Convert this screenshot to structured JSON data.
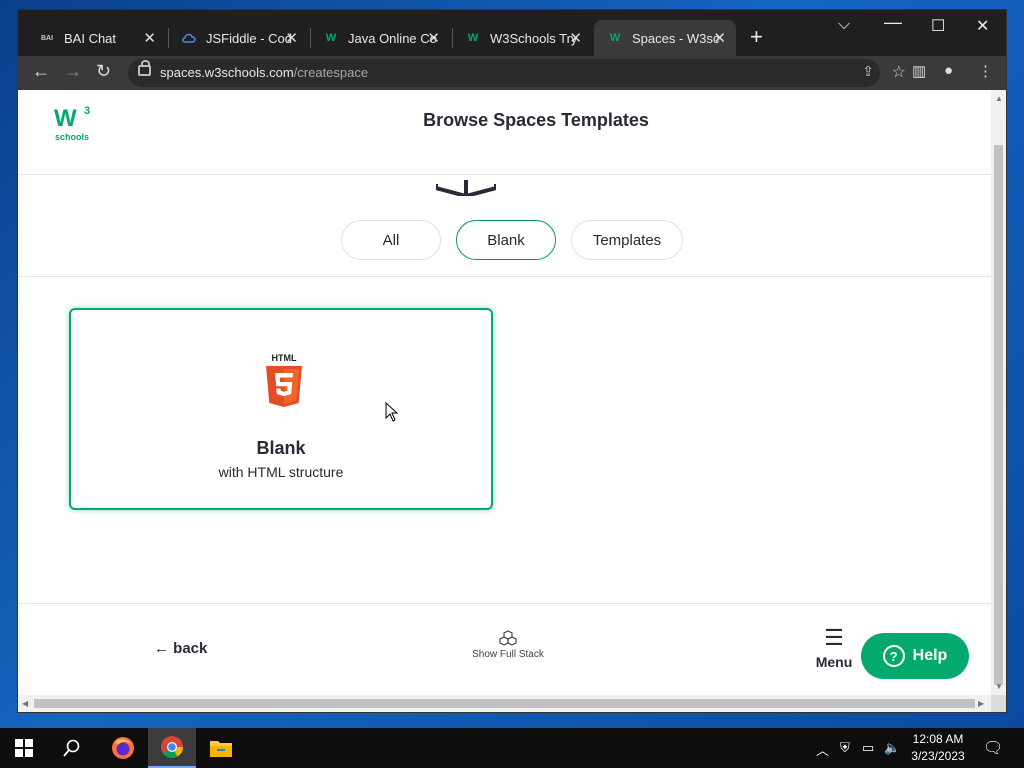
{
  "browser": {
    "tabs": [
      {
        "title": "BAI Chat",
        "favicon": "bai-favicon"
      },
      {
        "title": "JSFiddle - Cod",
        "favicon": "jsfiddle-favicon"
      },
      {
        "title": "Java Online Co",
        "favicon": "w3schools-favicon"
      },
      {
        "title": "W3Schools Try",
        "favicon": "w3schools-favicon"
      },
      {
        "title": "Spaces - W3sc",
        "favicon": "w3schools-favicon",
        "active": true
      }
    ],
    "url_host": "spaces.w3schools.com",
    "url_path": "/createspace"
  },
  "page": {
    "logo_text": "schools",
    "logo_sup": "3",
    "title": "Browse Spaces Templates",
    "filters": [
      {
        "label": "All",
        "active": false
      },
      {
        "label": "Blank",
        "active": true
      },
      {
        "label": "Templates",
        "active": false
      }
    ],
    "cards": [
      {
        "badge": "HTML",
        "title": "Blank",
        "subtitle": "with HTML structure",
        "icon": "html5-icon"
      }
    ],
    "footer": {
      "back_label": "back",
      "full_stack_label": "Show Full Stack",
      "menu_label": "Menu",
      "help_label": "Help"
    }
  },
  "taskbar": {
    "time": "12:08 AM",
    "date": "3/23/2023"
  },
  "colors": {
    "accent": "#04aa6d",
    "text": "#282a35",
    "tab_bg": "#1f1f1f",
    "toolbar_bg": "#3a3a3a"
  }
}
